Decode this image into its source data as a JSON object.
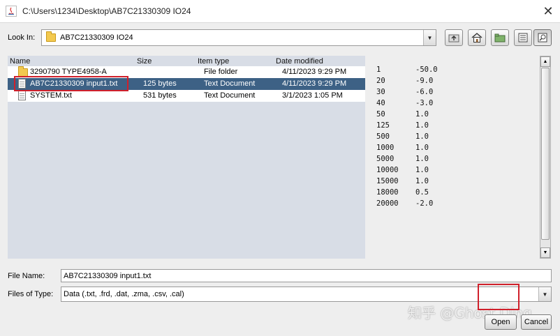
{
  "window": {
    "title": "C:\\Users\\1234\\Desktop\\AB7C21330309 IO24",
    "close_glyph": "✕"
  },
  "lookin": {
    "label": "Look In:",
    "value": "AB7C21330309 IO24"
  },
  "toolbar": {
    "buttons": [
      "up-one-level-icon",
      "home-icon",
      "new-folder-icon",
      "list-view-icon",
      "details-view-icon"
    ]
  },
  "filelist": {
    "columns": [
      "Name",
      "Size",
      "Item type",
      "Date modified"
    ],
    "rows": [
      {
        "name": "3290790 TYPE4958-A",
        "size": "",
        "type": "File folder",
        "date": "4/11/2023 9:29 PM",
        "icon": "folder-icon"
      },
      {
        "name": "AB7C21330309 input1.txt",
        "size": "125 bytes",
        "type": "Text Document",
        "date": "4/11/2023 9:29 PM",
        "icon": "text-file-icon",
        "selected": true
      },
      {
        "name": "SYSTEM.txt",
        "size": "531 bytes",
        "type": "Text Document",
        "date": "3/1/2023 1:05 PM",
        "icon": "text-file-icon"
      }
    ]
  },
  "preview": {
    "lines": [
      [
        "1",
        "-50.0"
      ],
      [
        "20",
        "-9.0"
      ],
      [
        "30",
        "-6.0"
      ],
      [
        "40",
        "-3.0"
      ],
      [
        "50",
        "1.0"
      ],
      [
        "125",
        "1.0"
      ],
      [
        "500",
        "1.0"
      ],
      [
        "1000",
        "1.0"
      ],
      [
        "5000",
        "1.0"
      ],
      [
        "10000",
        "1.0"
      ],
      [
        "15000",
        "1.0"
      ],
      [
        "18000",
        "0.5"
      ],
      [
        "20000",
        "-2.0"
      ]
    ]
  },
  "filename": {
    "label": "File Name:",
    "value": "AB7C21330309 input1.txt"
  },
  "filetype": {
    "label": "Files of Type:",
    "value": "Data (.txt, .frd, .dat, .zma, .csv, .cal)"
  },
  "buttons": {
    "open": "Open",
    "cancel": "Cancel"
  },
  "watermark": "知乎 @Ghost Ding",
  "colors": {
    "selection": "#3d6185",
    "highlight_box": "#d0202b",
    "dialog_bg": "#eeeeee"
  }
}
